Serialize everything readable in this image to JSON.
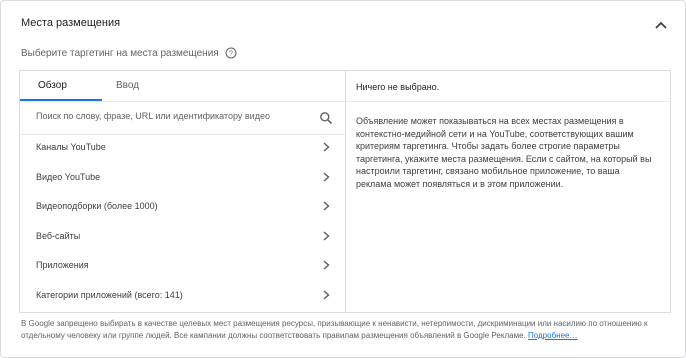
{
  "header": {
    "title": "Места размещения",
    "collapse_icon": "chevron-up-icon"
  },
  "subtitle": {
    "text": "Выберите таргетинг на места размещения",
    "help_icon": "help-icon"
  },
  "left_panel": {
    "tabs": [
      {
        "label": "Обзор",
        "active": true
      },
      {
        "label": "Ввод",
        "active": false
      }
    ],
    "search": {
      "placeholder": "Поиск по слову, фразе, URL или идентификатору видео",
      "value": "",
      "icon": "search-icon"
    },
    "items": [
      {
        "label": "Каналы YouTube"
      },
      {
        "label": "Видео YouTube"
      },
      {
        "label": "Видеоподборки (более 1000)"
      },
      {
        "label": "Веб-сайты"
      },
      {
        "label": "Приложения"
      },
      {
        "label": "Категории приложений (всего: 141)"
      }
    ]
  },
  "right_panel": {
    "header": "Ничего не выбрано.",
    "body": "Объявление может показываться на всех местах размещения в контекстно-медийной сети и на YouTube, соответствующих вашим критериям таргетинга. Чтобы задать более строгие параметры таргетинга, укажите места размещения. Если с сайтом, на который вы настроили таргетинг, связано мобильное приложение, то ваша реклама может появляться и в этом приложении."
  },
  "footer": {
    "text": "В Google запрещено выбирать в качестве целевых мест размещения ресурсы, призывающие к ненависти, нетерпимости, дискриминации или насилию по отношению к отдельному человеку или группе людей. Все кампании должны соответствовать правилам размещения объявлений в Google Рекламе.",
    "link": "Подробнее…"
  },
  "colors": {
    "accent": "#1a73e8",
    "border": "#dadce0",
    "text": "#3c4043"
  }
}
